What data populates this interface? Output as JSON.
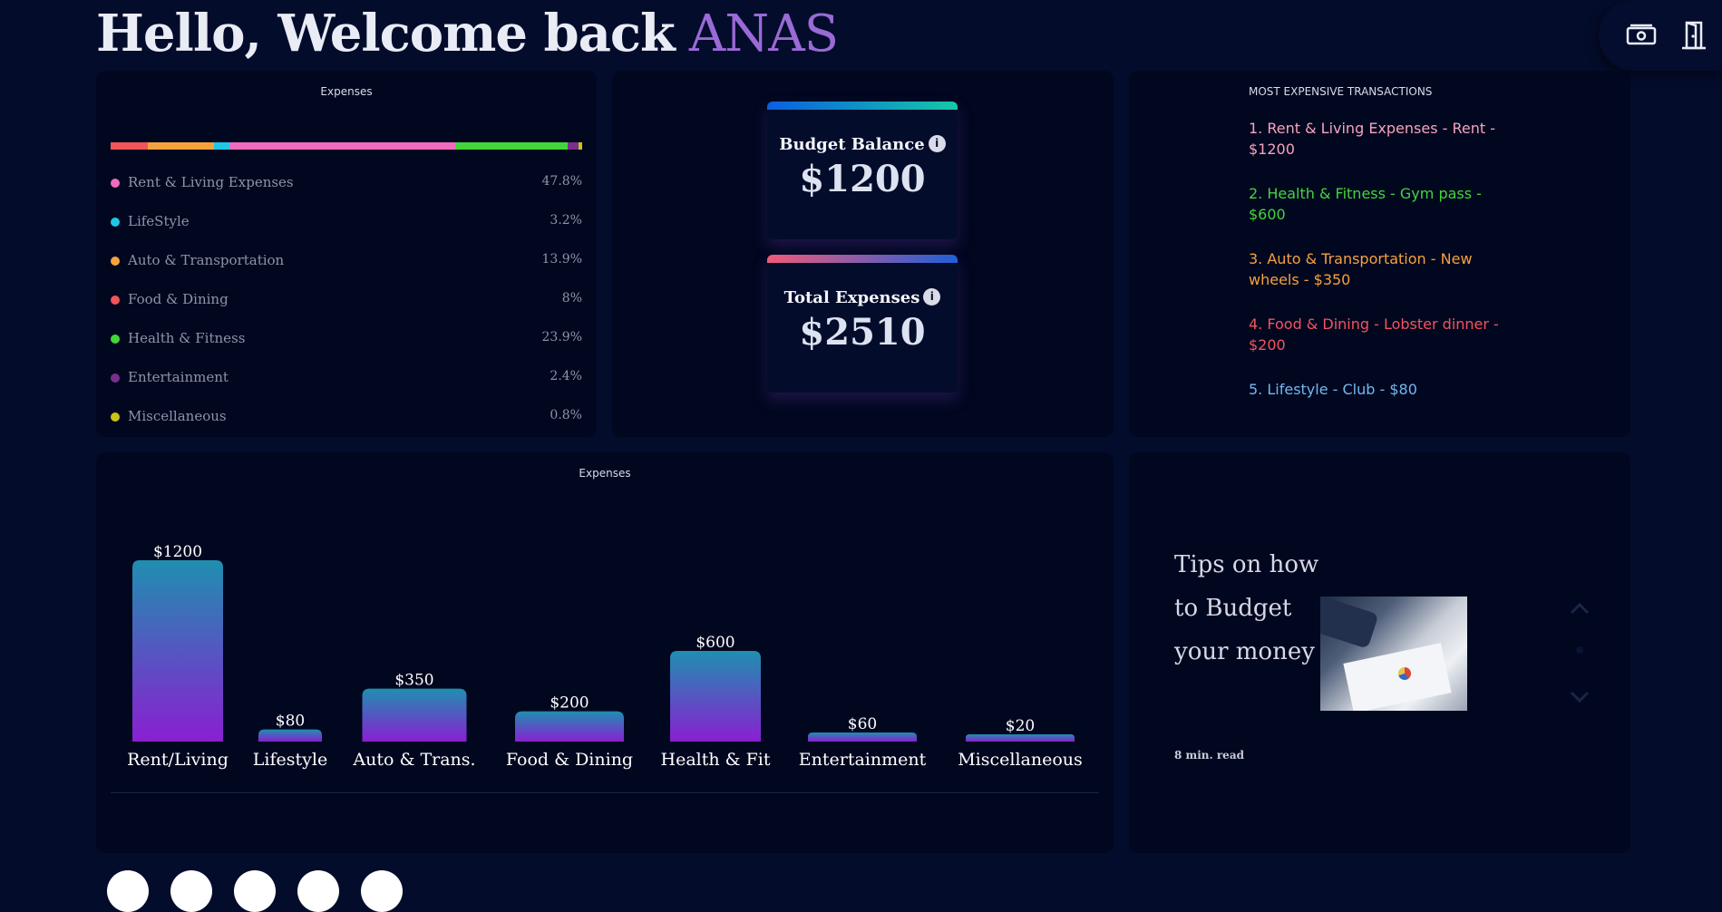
{
  "header": {
    "greeting": "Hello, Welcome back",
    "username": "ANAS"
  },
  "top_actions": [
    {
      "icon": "money-icon"
    },
    {
      "icon": "door-exit-icon"
    }
  ],
  "expenses_panel": {
    "title": "Expenses",
    "items": [
      {
        "label": "Rent & Living Expenses",
        "percent": "47.8%",
        "color": "#f06bbd"
      },
      {
        "label": "LifeStyle",
        "percent": "3.2%",
        "color": "#1fc7e6"
      },
      {
        "label": "Auto & Transportation",
        "percent": "13.9%",
        "color": "#f5a23c"
      },
      {
        "label": "Food & Dining",
        "percent": "8%",
        "color": "#f2545b"
      },
      {
        "label": "Health & Fitness",
        "percent": "23.9%",
        "color": "#43d63a"
      },
      {
        "label": "Entertainment",
        "percent": "2.4%",
        "color": "#7a2f8c"
      },
      {
        "label": "Miscellaneous",
        "percent": "0.8%",
        "color": "#c9c417"
      }
    ]
  },
  "balance": {
    "budget_label": "Budget Balance",
    "budget_value": "$1200",
    "expenses_label": "Total Expenses",
    "expenses_value": "$2510",
    "info_glyph": "i"
  },
  "transactions": {
    "title": "MOST EXPENSIVE TRANSACTIONS",
    "items": [
      {
        "text": "1. Rent & Living Expenses - Rent - $1200",
        "color": "#f6a3bd"
      },
      {
        "text": "2. Health & Fitness - Gym pass - $600",
        "color": "#43d63a"
      },
      {
        "text": "3. Auto & Transportation - New wheels - $350",
        "color": "#f5a23c"
      },
      {
        "text": "4. Food & Dining - Lobster dinner - $200",
        "color": "#f2545b"
      },
      {
        "text": "5. Lifestyle - Club - $80",
        "color": "#72b8f0"
      }
    ]
  },
  "chart_data": {
    "type": "bar",
    "title": "Expenses",
    "categories": [
      "Rent/Living",
      "Lifestyle",
      "Auto & Trans.",
      "Food & Dining",
      "Health & Fit",
      "Entertainment",
      "Miscellaneous"
    ],
    "values": [
      1200,
      80,
      350,
      200,
      600,
      60,
      20
    ],
    "value_labels": [
      "$1200",
      "$80",
      "$350",
      "$200",
      "$600",
      "$60",
      "$20"
    ],
    "ylim": [
      0,
      1200
    ],
    "grid": false,
    "colors": {
      "top": "#1f8fb0",
      "bottom": "#8a1fd1"
    }
  },
  "tips": {
    "heading": "Tips on how to Budget your money",
    "read_time": "8 min. read",
    "image": "business-meeting-charts-photo"
  },
  "bottom_dots": 5
}
